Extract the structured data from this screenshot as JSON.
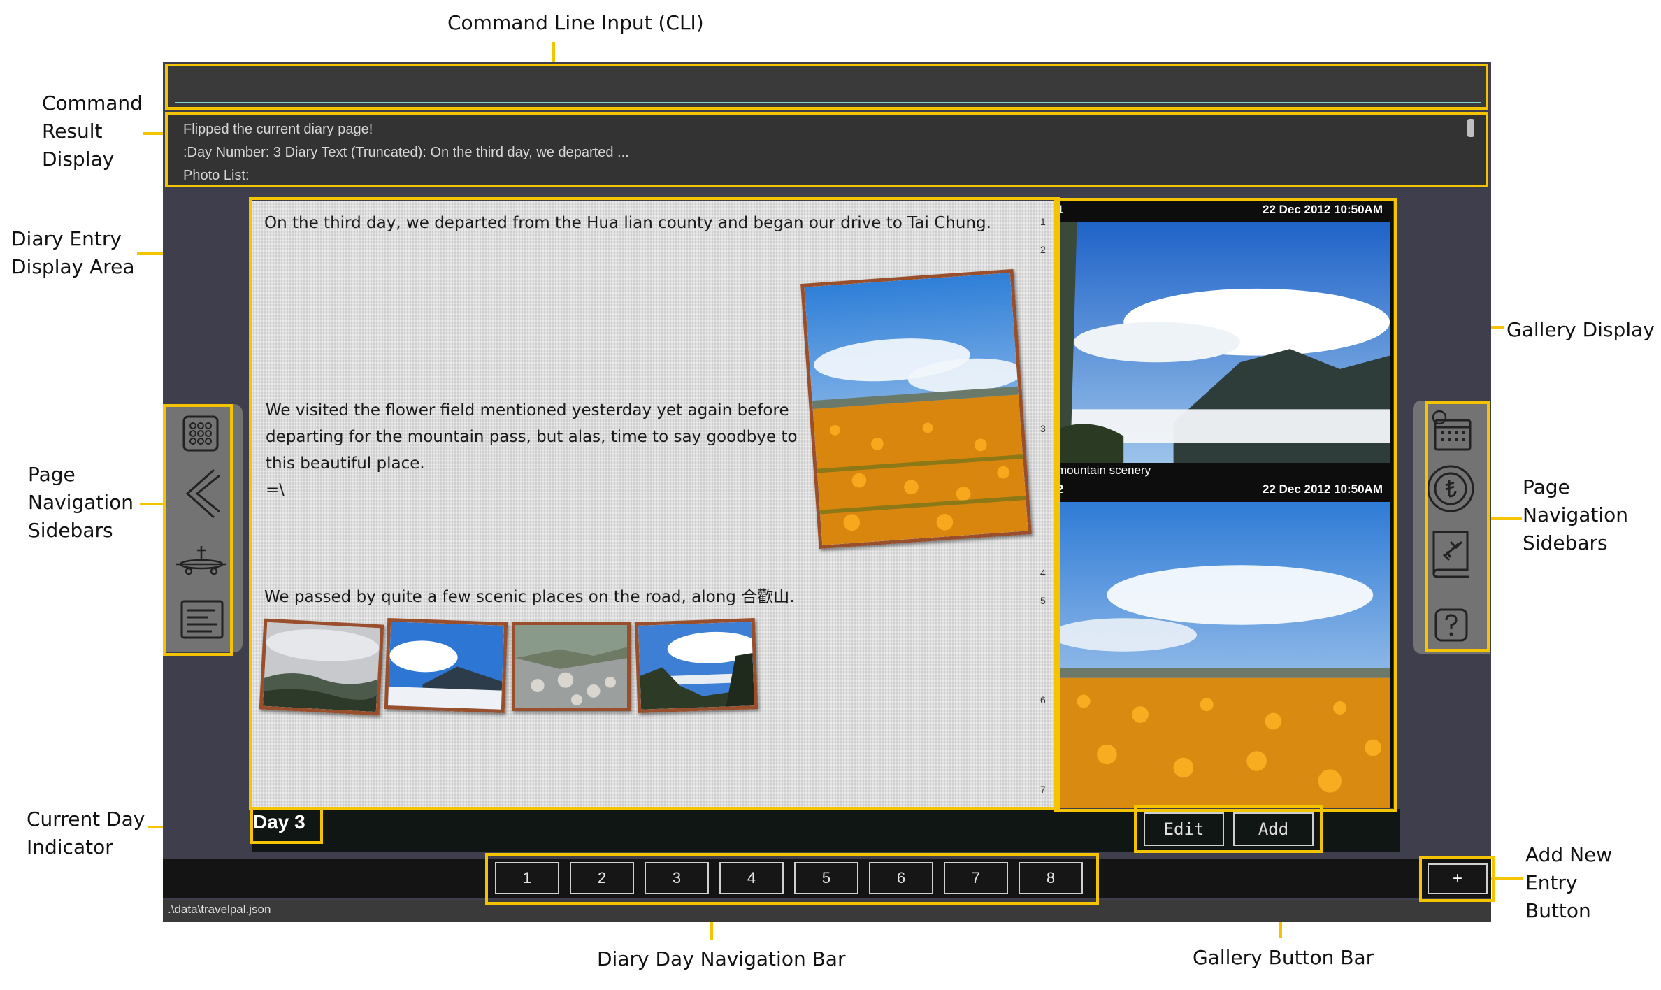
{
  "annotations": {
    "cli": "Command Line Input (CLI)",
    "result_1": "Command",
    "result_2": "Result",
    "result_3": "Display",
    "diary_1": "Diary Entry",
    "diary_2": "Display Area",
    "gallery": "Gallery Display",
    "left_nav_1": "Page",
    "left_nav_2": "Navigation",
    "left_nav_3": "Sidebars",
    "right_nav_1": "Page",
    "right_nav_2": "Navigation",
    "right_nav_3": "Sidebars",
    "day_ind_1": "Current Day",
    "day_ind_2": "Indicator",
    "add_entry_1": "Add New",
    "add_entry_2": "Entry",
    "add_entry_3": "Button",
    "day_nav_bar": "Diary Day Navigation Bar",
    "gallery_btn_bar": "Gallery Button Bar"
  },
  "cli": {
    "value": ""
  },
  "result": {
    "line1": "Flipped the current diary page!",
    "line2": ":Day Number: 3 Diary Text (Truncated): On the third day, we departed ...",
    "line3": "Photo List:"
  },
  "diary": {
    "para1": "On the third day, we departed from the Hua lian county and began our drive to Tai Chung.",
    "para2_l1": "We visited the flower field mentioned yesterday yet again before",
    "para2_l2": "departing for the mountain pass, but alas, time to say goodbye to",
    "para2_l3": "this beautiful place.",
    "para2_l4": "=\\",
    "para3": "We passed by quite a few scenic places on the road, along 合歡山.",
    "line_numbers": [
      "1",
      "2",
      "3",
      "4",
      "5",
      "6",
      "7"
    ]
  },
  "gallery": {
    "item1": {
      "index": "1",
      "date": "22 Dec 2012 10:50AM",
      "caption": "mountain scenery"
    },
    "item2": {
      "index": "2",
      "date": "22 Dec 2012 10:50AM"
    }
  },
  "day_indicator": "Day 3",
  "gallery_buttons": {
    "edit": "Edit",
    "add": "Add"
  },
  "day_nav": [
    "1",
    "2",
    "3",
    "4",
    "5",
    "6",
    "7",
    "8"
  ],
  "add_entry_button": "+",
  "status": {
    "path": ".\\data\\travelpal.json"
  },
  "icons": {
    "left": [
      "grid-icon",
      "back-chevron-icon",
      "airplane-icon",
      "list-icon"
    ],
    "right": [
      "calendar-icon",
      "currency-icon",
      "travel-book-icon",
      "help-icon"
    ]
  },
  "colors": {
    "accent_highlight": "#f5c400",
    "cli_underline": "#7fd6d0",
    "photo_frame": "#9a4f2c"
  }
}
